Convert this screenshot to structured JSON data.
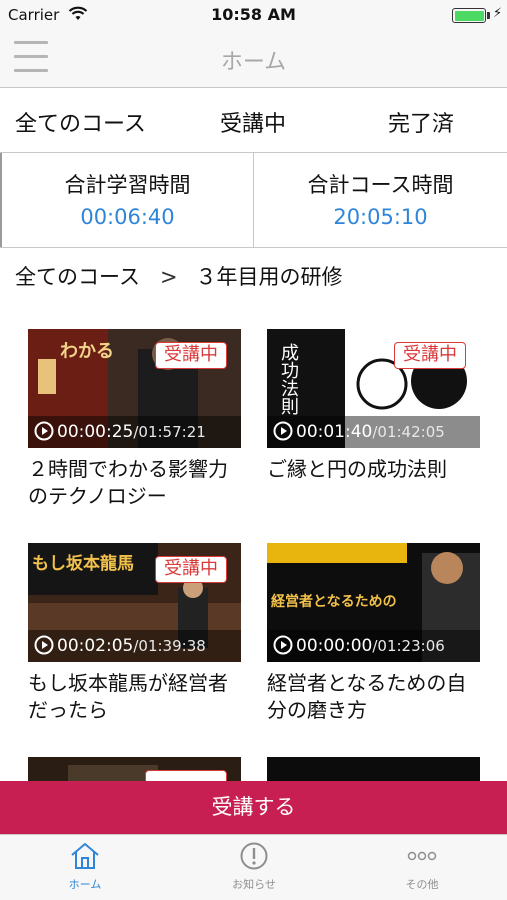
{
  "status_bar": {
    "carrier": "Carrier",
    "time": "10:58 AM",
    "battery_level": 1.0,
    "battery_color": "#4cd964"
  },
  "nav": {
    "title": "ホーム",
    "menu_icon": "hamburger-menu-icon"
  },
  "segments": [
    {
      "label": "全てのコース"
    },
    {
      "label": "受講中"
    },
    {
      "label": "完了済"
    }
  ],
  "stats": {
    "study_time_label": "合計学習時間",
    "study_time_value": "00:06:40",
    "course_time_label": "合計コース時間",
    "course_time_value": "20:05:10",
    "value_color": "#2f86d8"
  },
  "breadcrumb": {
    "root": "全てのコース",
    "separator": ">",
    "current": "３年目用の研修"
  },
  "courses": [
    {
      "title": "２時間でわかる影響力のテクノロジー",
      "badge": "受講中",
      "current": "00:00:25",
      "total": "/01:57:21",
      "thumb_text": "わかる"
    },
    {
      "title": "ご縁と円の成功法則",
      "badge": "受講中",
      "current": "00:01:40",
      "total": "/01:42:05",
      "thumb_text": "成功法則"
    },
    {
      "title": "もし坂本龍馬が経営者だったら",
      "badge": "受講中",
      "current": "00:02:05",
      "total": "/01:39:38",
      "thumb_text": "もし坂本龍馬"
    },
    {
      "title": "経営者となるための自分の磨き方",
      "badge": "",
      "current": "00:00:00",
      "total": "/01:23:06",
      "thumb_text": "経営者となるための"
    }
  ],
  "cta": {
    "label": "受講する",
    "color": "#c81f52"
  },
  "tabbar": [
    {
      "label": "ホーム",
      "icon": "home-icon",
      "active": true
    },
    {
      "label": "お知らせ",
      "icon": "exclamation-circle-icon",
      "active": false
    },
    {
      "label": "その他",
      "icon": "more-dots-icon",
      "active": false
    }
  ],
  "accent_color": "#2f86d8",
  "badge_color": "#d93a3a"
}
